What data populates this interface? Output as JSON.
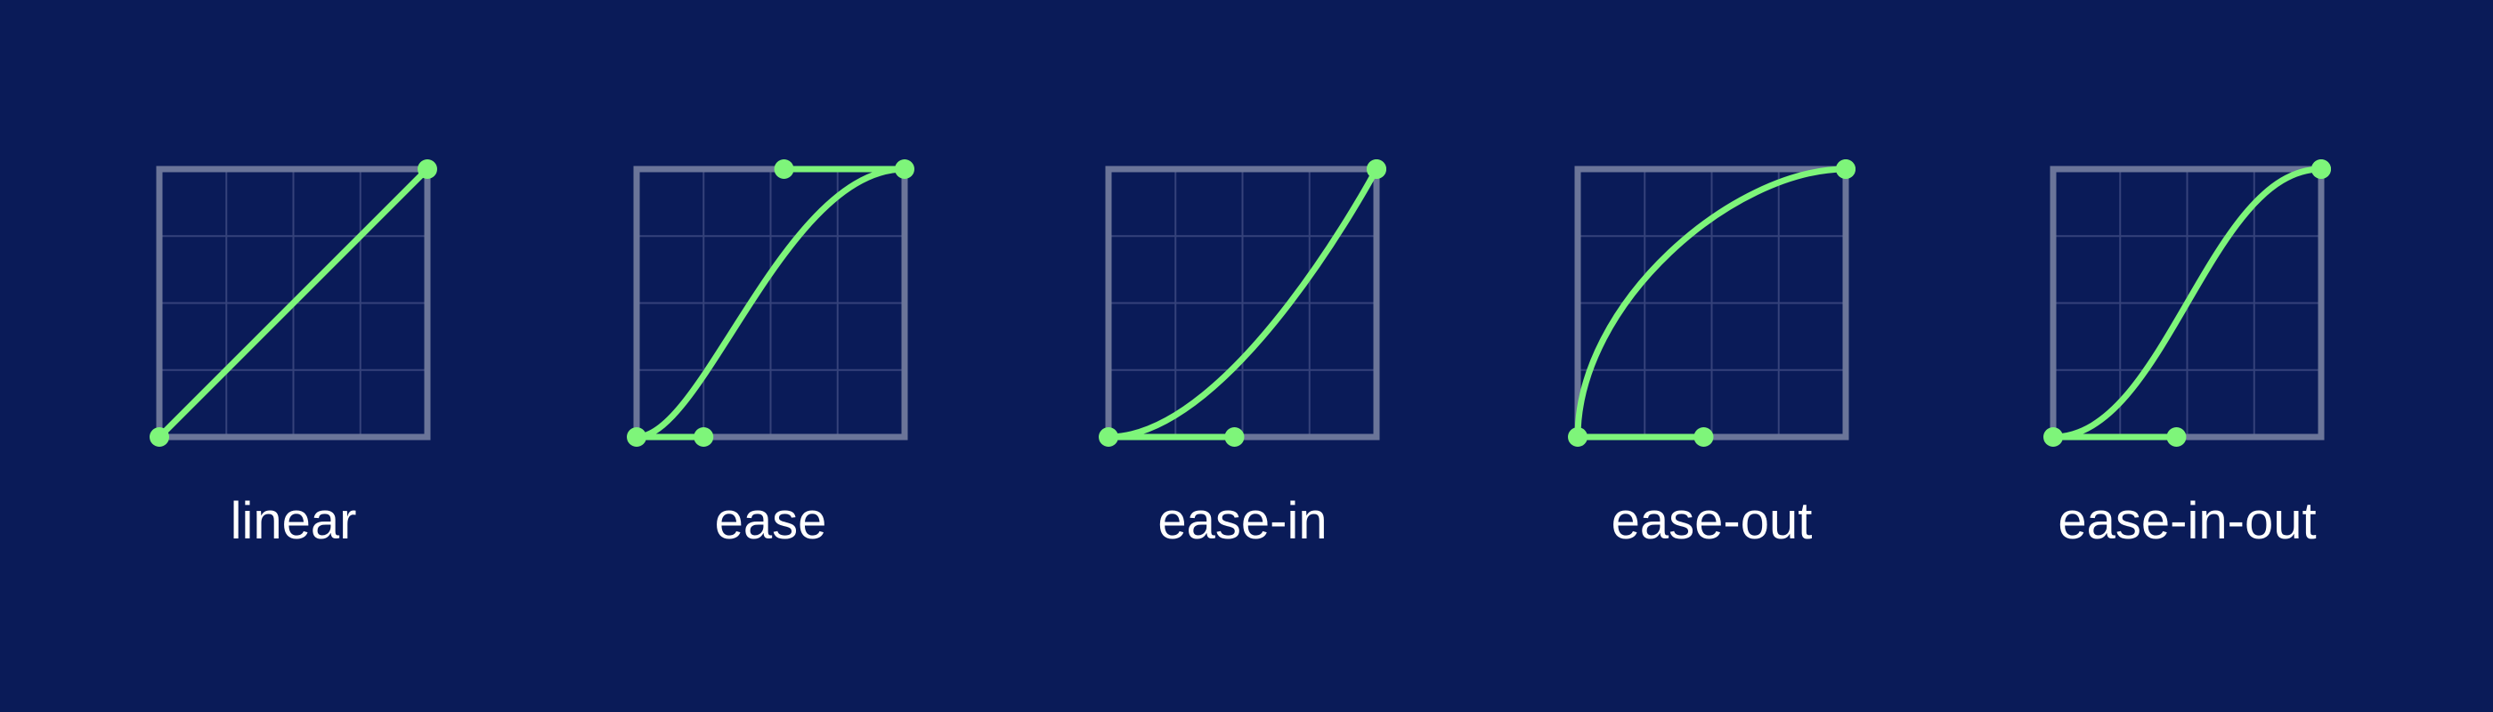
{
  "colors": {
    "background": "#0a1b58",
    "curve": "#7ef57a",
    "frame": "#6b7599",
    "grid": "#35427a",
    "label": "#ffffff"
  },
  "panels": [
    {
      "label": "linear",
      "p1": [
        0,
        0
      ],
      "p2": [
        1,
        1
      ]
    },
    {
      "label": "ease",
      "p1": [
        0.25,
        0
      ],
      "p2": [
        0.55,
        1
      ]
    },
    {
      "label": "ease-in",
      "p1": [
        0.47,
        0
      ],
      "p2": [
        1,
        1
      ]
    },
    {
      "label": "ease-out",
      "p1": [
        0.47,
        0
      ],
      "p2": [
        1,
        1
      ],
      "curve_p1": [
        0,
        0.5
      ],
      "curve_p2": [
        0.58,
        1
      ]
    },
    {
      "label": "ease-in-out",
      "p1": [
        0.46,
        0
      ],
      "p2": [
        1,
        1
      ],
      "curve_p1": [
        0.42,
        0
      ],
      "curve_p2": [
        0.58,
        1
      ]
    }
  ]
}
